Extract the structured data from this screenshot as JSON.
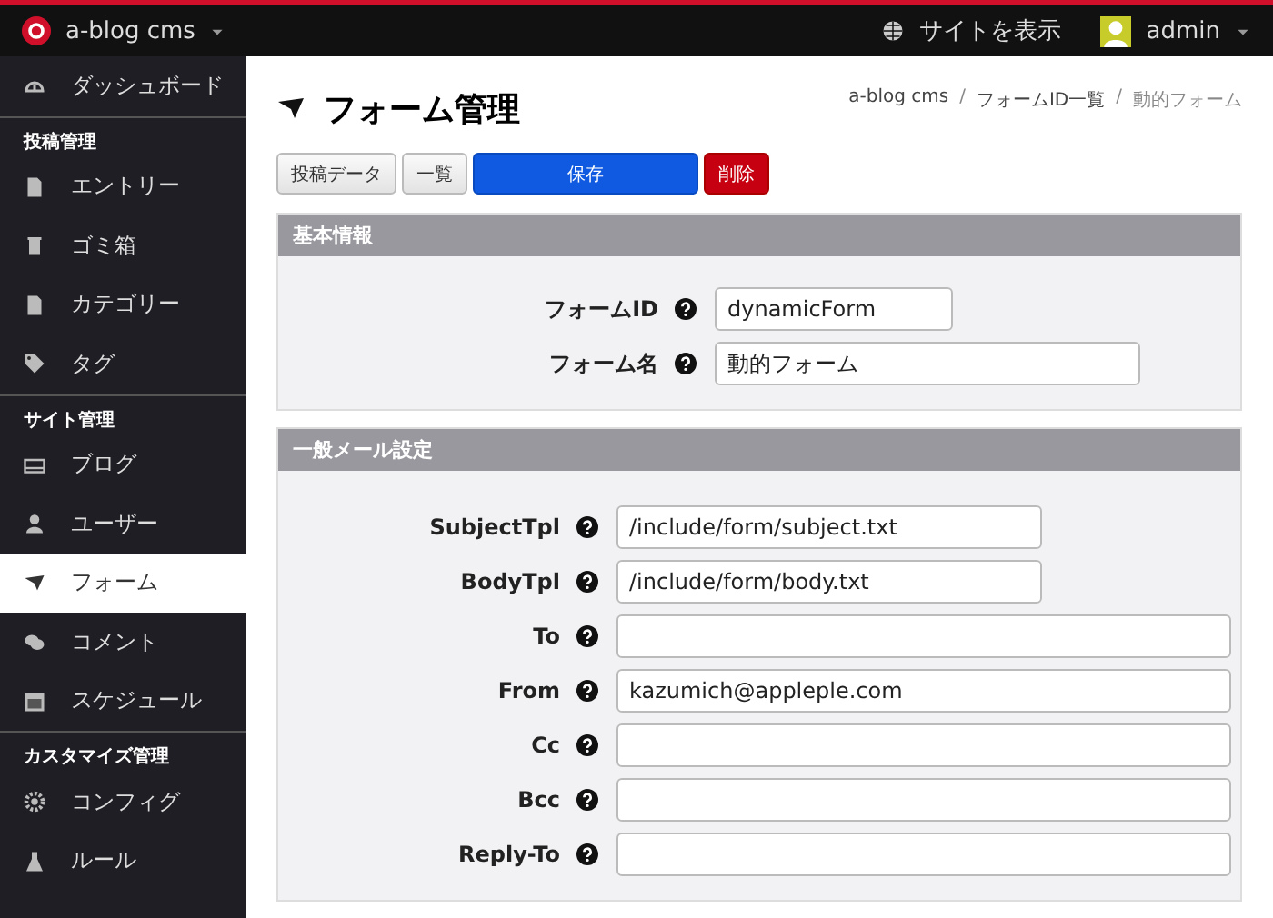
{
  "topbar": {
    "brand": "a-blog cms",
    "view_site": "サイトを表示",
    "user": "admin"
  },
  "sidebar": {
    "sections": [
      {
        "items": [
          {
            "label": "ダッシュボード",
            "selected": false
          }
        ]
      },
      {
        "heading": "投稿管理",
        "items": [
          {
            "label": "エントリー",
            "selected": false
          },
          {
            "label": "ゴミ箱",
            "selected": false
          },
          {
            "label": "カテゴリー",
            "selected": false
          },
          {
            "label": "タグ",
            "selected": false
          }
        ]
      },
      {
        "heading": "サイト管理",
        "items": [
          {
            "label": "ブログ",
            "selected": false
          },
          {
            "label": "ユーザー",
            "selected": false
          },
          {
            "label": "フォーム",
            "selected": true
          },
          {
            "label": "コメント",
            "selected": false
          },
          {
            "label": "スケジュール",
            "selected": false
          }
        ]
      },
      {
        "heading": "カスタマイズ管理",
        "items": [
          {
            "label": "コンフィグ",
            "selected": false
          },
          {
            "label": "ルール",
            "selected": false
          }
        ]
      }
    ]
  },
  "page": {
    "title": "フォーム管理",
    "breadcrumb": [
      "a-blog cms",
      "フォームID一覧",
      "動的フォーム"
    ],
    "breadcrumb_separator": "/"
  },
  "buttons": [
    {
      "label": "投稿データ",
      "kind": "default"
    },
    {
      "label": "一覧",
      "kind": "default"
    },
    {
      "label": "保存",
      "kind": "primary"
    },
    {
      "label": "削除",
      "kind": "danger"
    }
  ],
  "panels": [
    {
      "title": "基本情報",
      "fields": [
        {
          "label": "フォームID",
          "value": "dynamicForm",
          "kind": "short"
        },
        {
          "label": "フォーム名",
          "value": "動的フォーム",
          "kind": "medium"
        }
      ]
    },
    {
      "title": "一般メール設定",
      "fields": [
        {
          "label": "SubjectTpl",
          "value": "/include/form/subject.txt",
          "kind": "medium"
        },
        {
          "label": "BodyTpl",
          "value": "/include/form/body.txt",
          "kind": "medium"
        },
        {
          "label": "To",
          "kind": "long"
        },
        {
          "label": "From",
          "value": "kazumich@appleple.com",
          "kind": "long"
        },
        {
          "label": "Cc",
          "kind": "long"
        },
        {
          "label": "Bcc",
          "kind": "long"
        },
        {
          "label": "Reply-To",
          "kind": "long"
        }
      ]
    }
  ]
}
